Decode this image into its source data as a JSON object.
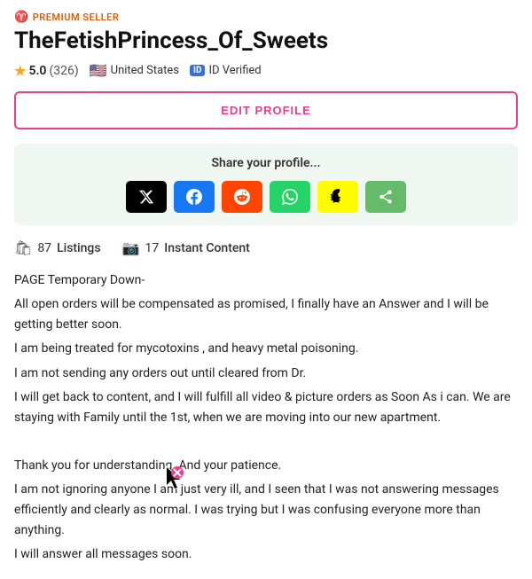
{
  "profile": {
    "premium_label": "PREMIUM SELLER",
    "username": "TheFetishPrincess_Of_Sweets",
    "rating_value": "5.0",
    "rating_count": "(326)",
    "location": "United States",
    "id_verified": "ID Verified",
    "edit_button": "EDIT PROFILE"
  },
  "share": {
    "title": "Share your profile...",
    "buttons": [
      {
        "label": "𝕏",
        "platform": "twitter"
      },
      {
        "label": "f",
        "platform": "facebook"
      },
      {
        "label": "🔴",
        "platform": "reddit"
      },
      {
        "label": "✔",
        "platform": "whatsapp"
      },
      {
        "label": "👻",
        "platform": "snapchat"
      },
      {
        "label": "⬆",
        "platform": "share"
      }
    ]
  },
  "stats": {
    "listings_count": "87",
    "listings_label": "Listings",
    "instant_count": "17",
    "instant_label": "Instant Content"
  },
  "bio": {
    "line1": "PAGE Temporary Down-",
    "line2": "All open orders will be compensated as promised, I finally have an Answer and I will be getting better soon.",
    "line3": "I am being treated for mycotoxins , and heavy metal poisoning.",
    "line4": "I am not sending any orders out until cleared from Dr.",
    "line5": "I will get back to content, and I will fulfill all video & picture orders as Soon As i can. We are staying with Family until the 1st, when we are moving into our new apartment.",
    "spacer": "",
    "line6": "Thank you for understanding. And your patience.",
    "line7": "I am not ignoring anyone I am just very ill, and I seen that I was not answering messages efficiently and clearly as normal. I was trying but I was confusing everyone more than anything.",
    "line8": "I will answer all messages soon."
  }
}
